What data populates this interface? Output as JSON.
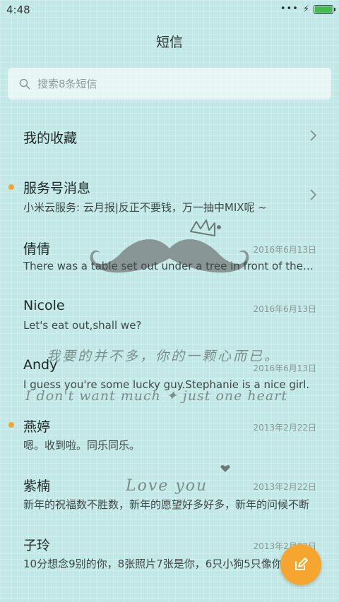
{
  "status_bar": {
    "time": "4:48",
    "more_icon": "more-dots-icon",
    "charging_icon": "charging-bolt-icon",
    "battery_icon": "battery-icon"
  },
  "header": {
    "title": "短信"
  },
  "search": {
    "placeholder": "搜索8条短信",
    "icon": "search-icon"
  },
  "favorites": {
    "label": "我的收藏"
  },
  "conversations": [
    {
      "name": "服务号消息",
      "preview": "小米云服务: 云月报|反正不要钱，万一抽中MIX呢 ~",
      "date": "",
      "unread": true,
      "chevron": true
    },
    {
      "name": "倩倩",
      "preview": "There was a table set out under a tree in front of the house",
      "date": "2016年6月13日",
      "unread": false
    },
    {
      "name": "Nicole",
      "preview": "Let's eat out,shall we?",
      "date": "2016年6月13日",
      "unread": false
    },
    {
      "name": "Andy",
      "preview": "I guess you're some lucky guy.Stephanie is a nice girl.",
      "date": "2016年6月13日",
      "unread": false
    },
    {
      "name": "燕婷",
      "preview": "嗯。收到啦。同乐同乐。",
      "date": "2013年2月22日",
      "unread": true
    },
    {
      "name": "紫楠",
      "preview": "新年的祝福数不胜数，新年的愿望好多好多，新年的问候不断",
      "date": "2013年2月22日",
      "unread": false
    },
    {
      "name": "子玲",
      "preview": "10分想念9别的你，8张照片7张是你，6只小狗5只像你",
      "date": "2013年2月22日",
      "unread": false
    }
  ],
  "wallpaper": {
    "line1": "我要的并不多，你的一颗心而已。",
    "line2": "I don't want much ✦ just one heart",
    "line3": "Love you"
  },
  "fab": {
    "icon": "compose-icon"
  },
  "colors": {
    "accent": "#f6a62e",
    "unread_dot": "#f3a431",
    "background": "#bfe9e7"
  }
}
